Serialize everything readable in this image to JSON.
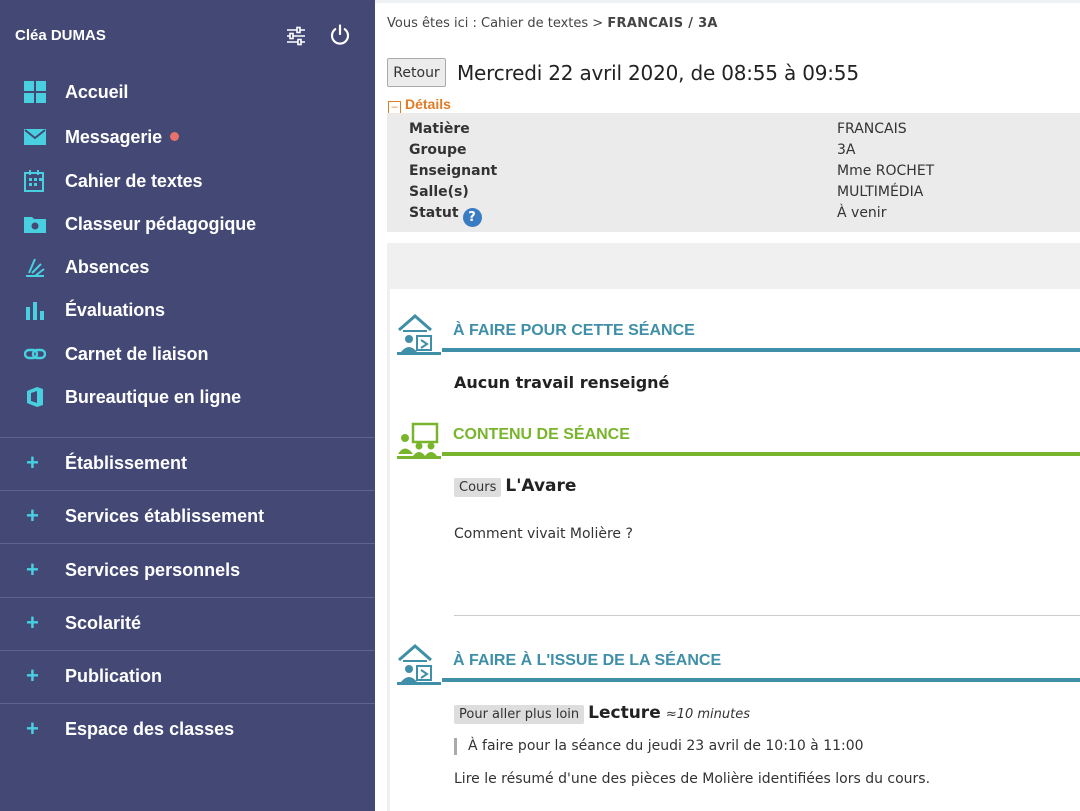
{
  "user": {
    "name": "Cléa DUMAS"
  },
  "nav": {
    "items": [
      {
        "label": "Accueil",
        "icon": "dashboard-grid-icon"
      },
      {
        "label": "Messagerie",
        "icon": "envelope-icon",
        "unread": true
      },
      {
        "label": "Cahier de textes",
        "icon": "calendar-book-icon"
      },
      {
        "label": "Classeur pédagogique",
        "icon": "folder-icon"
      },
      {
        "label": "Absences",
        "icon": "absences-icon"
      },
      {
        "label": "Évaluations",
        "icon": "bar-chart-icon"
      },
      {
        "label": "Carnet de liaison",
        "icon": "link-icon"
      },
      {
        "label": "Bureautique en ligne",
        "icon": "office-icon"
      }
    ],
    "sections": [
      {
        "label": "Établissement"
      },
      {
        "label": "Services établissement"
      },
      {
        "label": "Services personnels"
      },
      {
        "label": "Scolarité"
      },
      {
        "label": "Publication"
      },
      {
        "label": "Espace des classes"
      }
    ]
  },
  "breadcrumb": {
    "prefix": "Vous êtes ici : Cahier de textes > ",
    "current": "FRANCAIS / 3A"
  },
  "header": {
    "back_label": "Retour",
    "title": "Mercredi 22 avril 2020, de 08:55 à 09:55"
  },
  "details": {
    "toggle_symbol": "–",
    "toggle_label": "Détails",
    "rows": [
      {
        "key": "Matière",
        "value": "FRANCAIS"
      },
      {
        "key": "Groupe",
        "value": "3A"
      },
      {
        "key": "Enseignant",
        "value": "Mme ROCHET"
      },
      {
        "key": "Salle(s)",
        "value": "MULTIMÉDIA"
      },
      {
        "key": "Statut",
        "value": "À venir"
      }
    ],
    "help_symbol": "?"
  },
  "sections": {
    "todo_before": {
      "title": "À FAIRE POUR CETTE SÉANCE",
      "empty_text": "Aucun travail renseigné"
    },
    "content": {
      "title": "CONTENU DE SÉANCE",
      "tag": "Cours",
      "item_title": "L'Avare",
      "description": "Comment vivait Molière ?"
    },
    "todo_after": {
      "title": "À FAIRE À L'ISSUE DE LA SÉANCE",
      "tag": "Pour aller plus loin",
      "item_title": "Lecture",
      "duration": "≈10 minutes",
      "due": "À faire pour la séance du jeudi 23 avril de 10:10 à 11:00",
      "description": "Lire le résumé d'une des pièces de Molière  identifiées lors du cours."
    }
  },
  "colors": {
    "sidebar": "#434874",
    "accent_cyan": "#49d0e0",
    "blue_section": "#3e8fa7",
    "green_section": "#79b52c",
    "orange": "#e07b26",
    "unread_dot": "#e8726b"
  }
}
